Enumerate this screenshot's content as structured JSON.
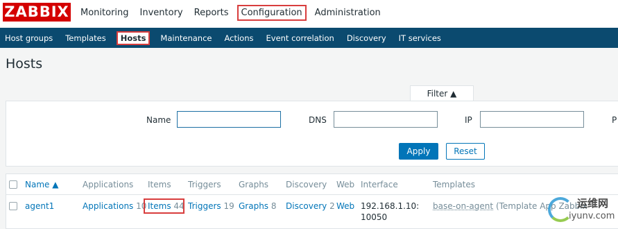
{
  "logo": "ZABBIX",
  "main_menu": [
    "Monitoring",
    "Inventory",
    "Reports",
    "Configuration",
    "Administration"
  ],
  "main_menu_selected": "Configuration",
  "sub_menu": [
    "Host groups",
    "Templates",
    "Hosts",
    "Maintenance",
    "Actions",
    "Event correlation",
    "Discovery",
    "IT services"
  ],
  "sub_menu_selected": "Hosts",
  "page_title": "Hosts",
  "filter": {
    "tab_label": "Filter ▲",
    "name_label": "Name",
    "dns_label": "DNS",
    "ip_label": "IP",
    "port_label": "P",
    "name_value": "",
    "dns_value": "",
    "ip_value": "",
    "apply_label": "Apply",
    "reset_label": "Reset"
  },
  "table": {
    "headers": {
      "name": "Name ▲",
      "applications": "Applications",
      "items": "Items",
      "triggers": "Triggers",
      "graphs": "Graphs",
      "discovery": "Discovery",
      "web": "Web",
      "interface": "Interface",
      "templates": "Templates"
    },
    "rows": [
      {
        "name": "agent1",
        "applications_label": "Applications",
        "applications_count": "10",
        "items_label": "Items",
        "items_count": "44",
        "triggers_label": "Triggers",
        "triggers_count": "19",
        "graphs_label": "Graphs",
        "graphs_count": "8",
        "discovery_label": "Discovery",
        "discovery_count": "2",
        "web_label": "Web",
        "interface_line1": "192.168.1.10:",
        "interface_line2": "10050",
        "template_main": "base-on-agent",
        "template_rest": "(Template App Zabbix"
      }
    ]
  },
  "watermark": {
    "line1": "运维网",
    "line2": "iyunv.com"
  },
  "colors": {
    "brand_red": "#d40000",
    "nav_blue": "#0b4a6f",
    "link_blue": "#0275b8",
    "highlight_red": "#d83d3d"
  }
}
